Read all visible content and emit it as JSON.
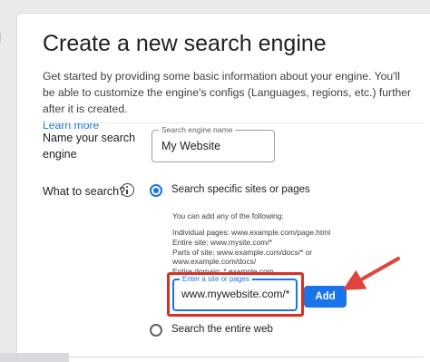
{
  "page": {
    "title": "Create a new search engine",
    "intro_text": "Get started by providing some basic information about your engine. You'll be able to customize the engine's configs (Languages, regions, etc.) further after it is created.",
    "learn_more": "Learn more"
  },
  "name_section": {
    "label": "Name your search engine",
    "field_label": "Search engine name",
    "field_value": "My Website"
  },
  "what_section": {
    "label": "What to search?",
    "info_icon": "info-icon",
    "option_sites": "Search specific sites or pages",
    "option_sites_selected": true,
    "help_intro": "You can add any of the following:",
    "help_lines": [
      "Individual pages: www.example.com/page.html",
      "Entire site: www.mysite.com/*",
      "Parts of site: www.example.com/docs/* or",
      "www.example.com/docs/",
      "Entire domain: *.example.com"
    ],
    "site_field_label": "Enter a site or pages",
    "site_field_value": "www.mywebsite.com/*",
    "add_button": "Add",
    "option_web": "Search the entire web",
    "option_web_selected": false
  },
  "annotation": {
    "highlight_color": "#d93025",
    "arrow_color": "#e0443a"
  },
  "accent_color": "#1a73e8"
}
